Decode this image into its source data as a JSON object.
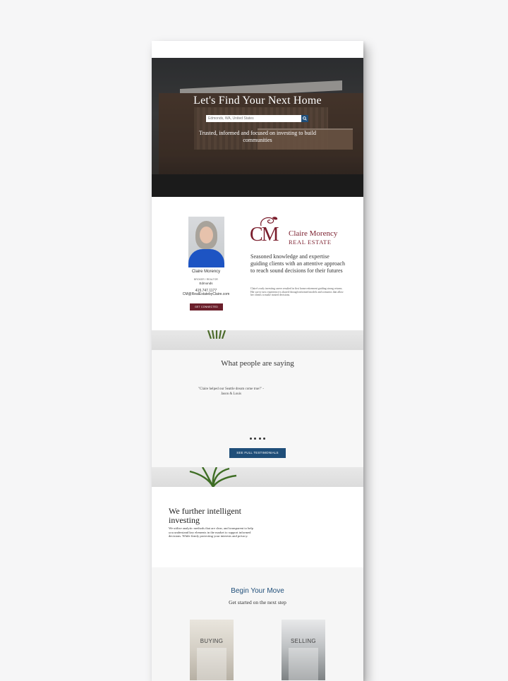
{
  "hero": {
    "title": "Let's Find Your Next Home",
    "search_placeholder": "Edmonds, WA, United States",
    "tagline": "Trusted, informed and focused on investing to build communities"
  },
  "agent": {
    "name": "Claire Morency",
    "title": "BROKER / REALTOR",
    "location": "Edmonds",
    "phone": "415.747.1177",
    "email": "CM@RealEstatebyClaire.com",
    "cta": "GET CONNECTED"
  },
  "brand": {
    "monogram": "CM",
    "name": "Claire Morency",
    "subtitle": "REAL ESTATE",
    "color": "#7a1d2c"
  },
  "pitch": {
    "headline": "Seasoned knowledge and expertise guiding clients with an attentive approach to reach sound decisions for their futures",
    "body": "Claire's early investing career resulted in first home retirement guiding strong returns. Her savvy now experience is shared through informed models and scenarios that allow her clients to make trusted decisions."
  },
  "testimonials": {
    "heading": "What people are saying",
    "quote": "\"Claire helped our Seattle dream come true!\" - Jason & Louis",
    "button": "SEE FULL TESTIMONIALS"
  },
  "invest": {
    "heading": "We further intelligent investing",
    "body": "We utilize analytic methods that are clear, and transparent to help you understand key elements in the market to support informed decisions. While firmly protecting your interests and privacy."
  },
  "begin": {
    "heading": "Begin Your Move",
    "subheading": "Get started on the next step",
    "tiles": [
      {
        "label": "BUYING"
      },
      {
        "label": "SELLING"
      }
    ]
  },
  "colors": {
    "accent_blue": "#1f4e79",
    "brand_red": "#7a1d2c"
  }
}
